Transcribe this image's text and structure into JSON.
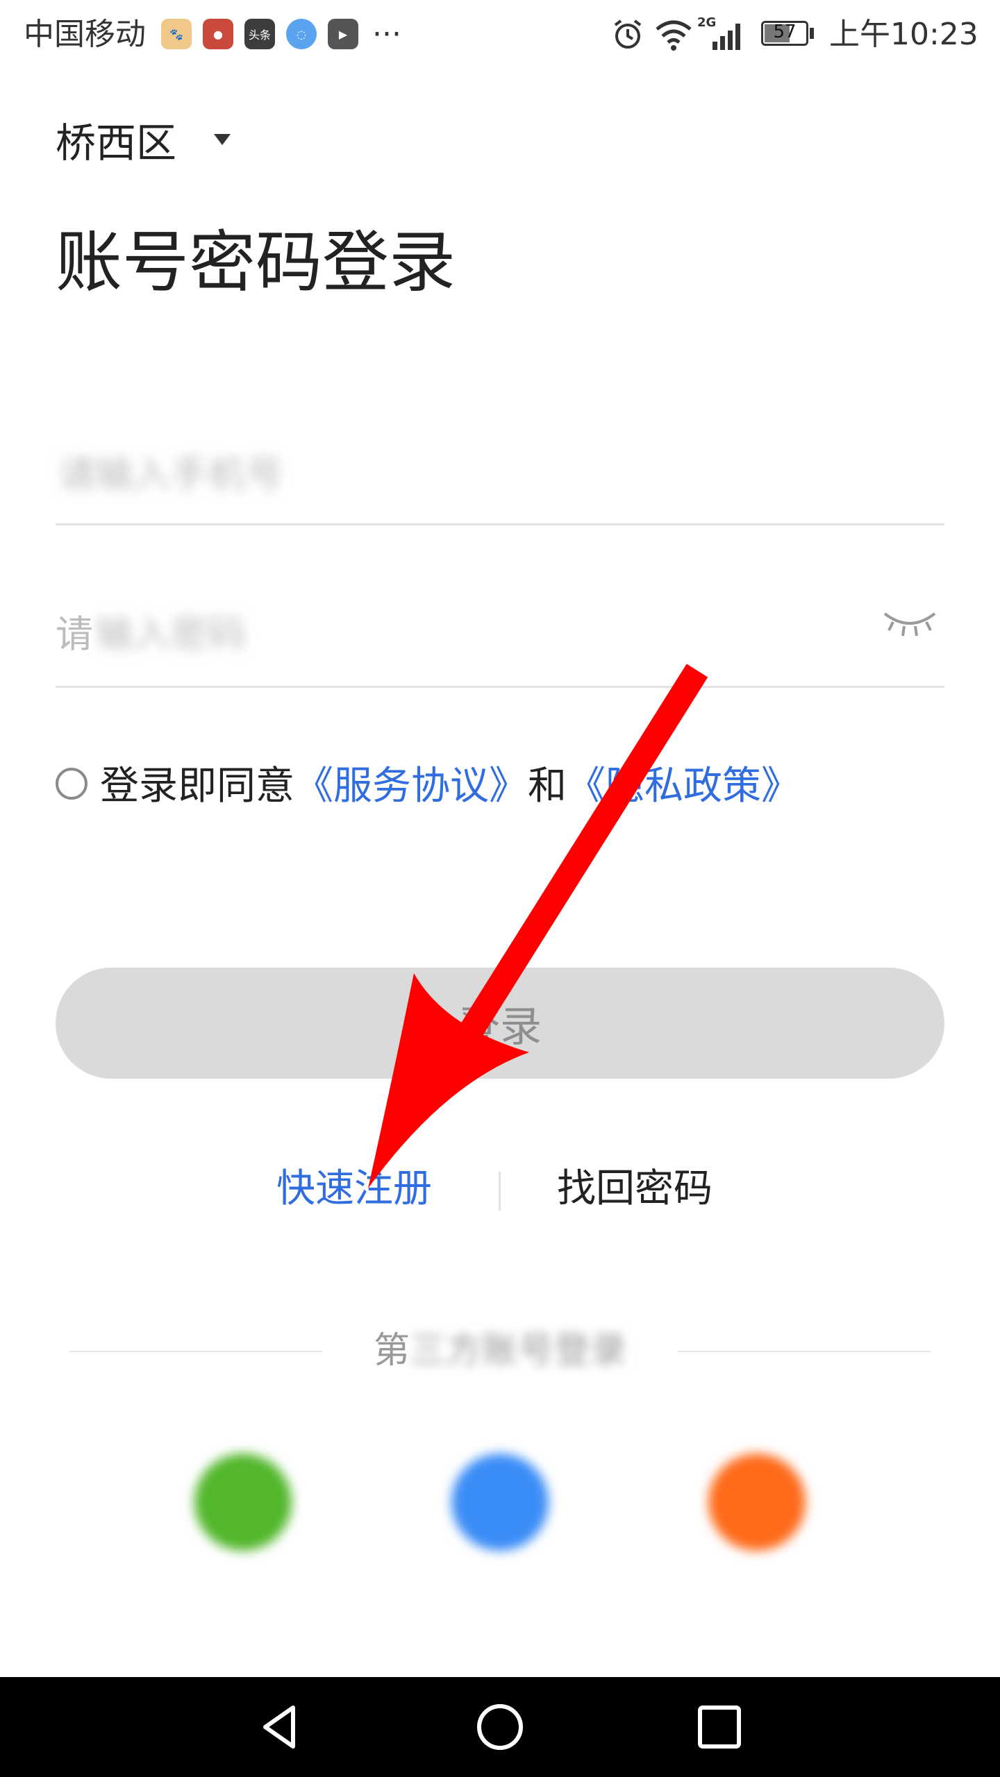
{
  "status_bar": {
    "carrier": "中国移动",
    "app_icons": [
      "baidu-icon",
      "app-red-icon",
      "toutiao-icon",
      "browser-icon",
      "video-icon"
    ],
    "toutiao_text": "头条",
    "more": "···",
    "network": "2G",
    "battery": "57",
    "time": "上午10:23"
  },
  "header": {
    "region": "桥西区",
    "title": "账号密码登录"
  },
  "form": {
    "account_placeholder": "请输入手机号",
    "password_placeholder_first": "请",
    "password_placeholder_rest": "输入密码"
  },
  "agreement": {
    "prefix": "登录即同意",
    "terms": "《服务协议》",
    "and": "和",
    "privacy": "《隐私政策》"
  },
  "login_button": "登录",
  "links": {
    "register": "快速注册",
    "forgot": "找回密码"
  },
  "third_party": {
    "label_first": "第",
    "label_rest": "三方账号登录",
    "providers": [
      {
        "icon": "wechat-icon",
        "color": "#52b72b"
      },
      {
        "icon": "qq-icon",
        "color": "#3a8cf6"
      },
      {
        "icon": "weibo-icon",
        "color": "#ff6a1a"
      }
    ]
  },
  "colors": {
    "link": "#2f6de0",
    "button_bg": "#dadada",
    "arrow": "#ff0000"
  }
}
